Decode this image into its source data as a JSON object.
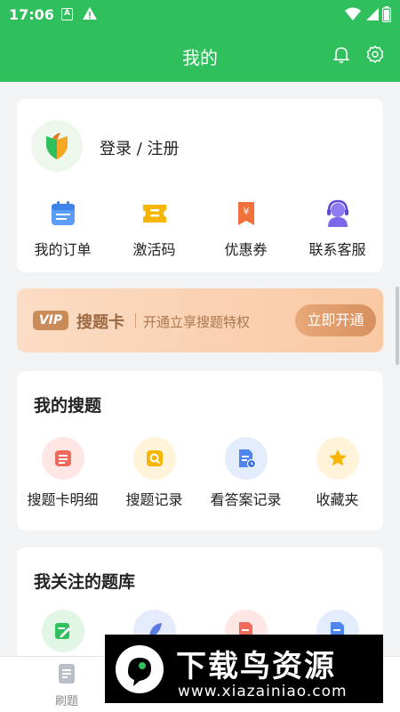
{
  "status_bar": {
    "time": "17:06",
    "badge": "A"
  },
  "app_bar": {
    "title": "我的"
  },
  "login": {
    "label": "登录 / 注册"
  },
  "quick_actions": [
    {
      "label": "我的订单",
      "icon": "calendar-icon"
    },
    {
      "label": "激活码",
      "icon": "ticket-icon"
    },
    {
      "label": "优惠券",
      "icon": "coupon-icon"
    },
    {
      "label": "联系客服",
      "icon": "headset-icon"
    }
  ],
  "vip": {
    "badge": "VIP",
    "title": "搜题卡",
    "desc": "开通立享搜题特权",
    "button": "立即开通"
  },
  "my_search": {
    "title": "我的搜题",
    "items": [
      {
        "label": "搜题卡明细",
        "icon": "card-detail-icon"
      },
      {
        "label": "搜题记录",
        "icon": "search-record-icon"
      },
      {
        "label": "看答案记录",
        "icon": "answer-record-icon"
      },
      {
        "label": "收藏夹",
        "icon": "star-icon"
      }
    ]
  },
  "followed_banks": {
    "title": "我关注的题库"
  },
  "bottom_nav": {
    "items": [
      {
        "label": "刷题"
      }
    ]
  },
  "watermark": {
    "text": "下载鸟资源",
    "url": "www.xiazainiao.com"
  },
  "colors": {
    "brand_green": "#2fbf5c",
    "vip_brown": "#9b6a43"
  }
}
